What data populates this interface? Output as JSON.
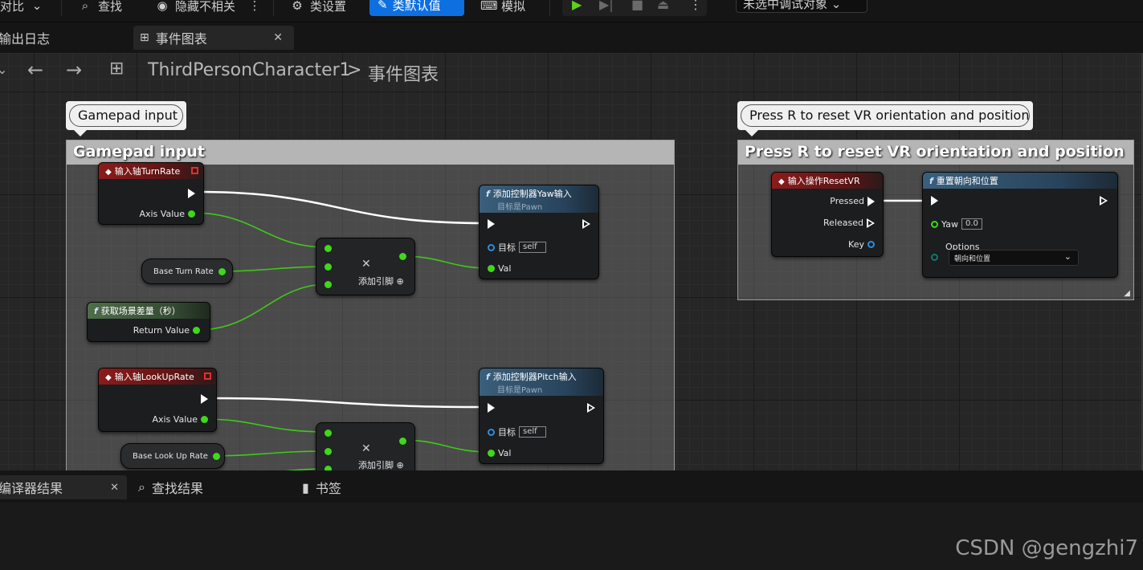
{
  "toolbar": {
    "diff_label": "对比",
    "find_label": "查找",
    "hide_unrelated_label": "隐藏不相关",
    "class_settings_label": "类设置",
    "class_defaults_label": "类默认值",
    "simulate_label": "模拟",
    "debug_object_label": "未选中调试对象"
  },
  "tabs": {
    "output_log": "输出日志",
    "event_graph": "事件图表"
  },
  "breadcrumb": {
    "blueprint": "ThirdPersonCharacter1",
    "separator": ">",
    "graph": "事件图表"
  },
  "comments": [
    {
      "bubble": "Gamepad input",
      "title": "Gamepad input"
    },
    {
      "bubble": "Press R to reset VR orientation and position",
      "title": "Press R to reset VR orientation and position"
    }
  ],
  "nodes": {
    "input_turn": {
      "title": "输入轴TurnRate",
      "axis_label": "Axis Value"
    },
    "input_lookup": {
      "title": "输入轴LookUpRate",
      "axis_label": "Axis Value"
    },
    "base_turn_rate": {
      "label": "Base Turn Rate"
    },
    "base_lookup_rate": {
      "label": "Base Look Up Rate"
    },
    "world_delta": {
      "title": "获取场景差量（秒）",
      "return_label": "Return Value"
    },
    "add_pin_1": {
      "label": "添加引脚"
    },
    "add_pin_2": {
      "label": "添加引脚"
    },
    "yaw_input": {
      "title": "添加控制器Yaw输入",
      "subtitle": "目标是Pawn",
      "target_label": "目标",
      "target_value": "self",
      "val_label": "Val"
    },
    "pitch_input": {
      "title": "添加控制器Pitch输入",
      "subtitle": "目标是Pawn",
      "target_label": "目标",
      "target_value": "self",
      "val_label": "Val"
    },
    "reset_vr_action": {
      "title": "输入操作ResetVR",
      "pressed_label": "Pressed",
      "released_label": "Released",
      "key_label": "Key"
    },
    "reset_orientation": {
      "title": "重置朝向和位置",
      "yaw_label": "Yaw",
      "yaw_value": "0.0",
      "options_label": "Options",
      "options_value": "朝向和位置"
    }
  },
  "bottom_tabs": {
    "compiler_results": "编译器结果",
    "find_results": "查找结果",
    "bookmarks": "书签"
  },
  "watermark": "CSDN @gengzhi7",
  "colors": {
    "accent_blue": "#0e6fe0",
    "exec_white": "#ffffff",
    "float_pin_green": "#3fd81a",
    "object_pin_blue": "#2c8fe0",
    "event_header_red": "#8c1b1b",
    "function_header_blue": "#3a5f7c",
    "pure_header_green": "#4f6d4a"
  },
  "icons": {
    "diff": "chevron-down-icon",
    "find": "search-icon",
    "hide": "eye-icon",
    "class_settings": "gear-icon",
    "class_defaults": "edit-icon",
    "simulate": "controller-icon",
    "play": "play-icon",
    "graph": "graph-icon",
    "back": "arrow-left-icon",
    "forward": "arrow-right-icon",
    "bookmark": "bookmark-icon"
  }
}
